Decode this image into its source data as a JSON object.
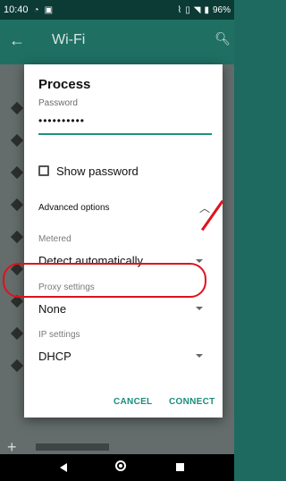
{
  "status_bar": {
    "time": "10:40",
    "icons_left": [
      "wifi-icon",
      "image-icon"
    ],
    "icons_right": [
      "nfc-icon",
      "vibrate-icon",
      "wifi-icon",
      "battery-icon"
    ],
    "battery": "96%"
  },
  "app_bar": {
    "title": "Wi-Fi"
  },
  "dialog": {
    "title": "Process",
    "password_label": "Password",
    "password_value": "••••••••••",
    "show_password_label": "Show password",
    "advanced_options_label": "Advanced options",
    "metered_label": "Metered",
    "metered_value": "Detect automatically",
    "proxy_label": "Proxy settings",
    "proxy_value": "None",
    "ip_label": "IP settings",
    "ip_value": "DHCP",
    "cancel_label": "CANCEL",
    "connect_label": "CONNECT"
  },
  "colors": {
    "accent": "#1b8d7c",
    "highlight": "#e0121c"
  }
}
